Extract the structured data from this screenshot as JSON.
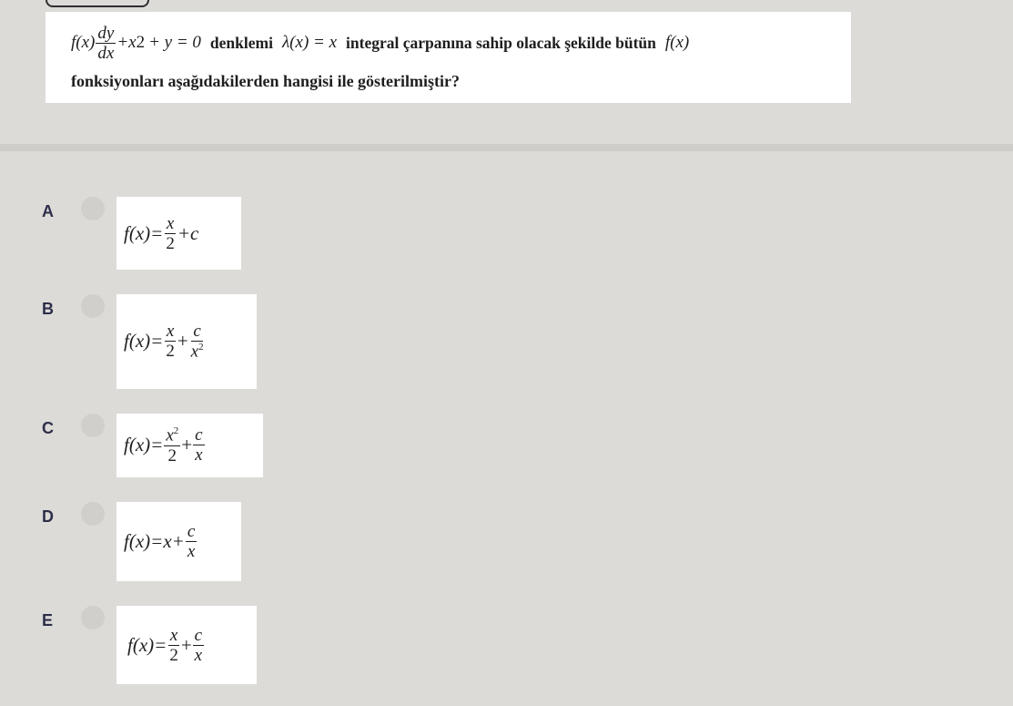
{
  "question": {
    "line1": {
      "f_of_x": "f(x)",
      "dy": "dy",
      "dx": "dx",
      "plus_x": "+x",
      "sq": "2",
      "plus_y_eq_0": "+ y = 0",
      "word_denklemi": "denklemi",
      "lambda": "λ(x) = x",
      "word_tail": "integral çarpanına sahip olacak şekilde bütün",
      "f_of_x_end": "f(x)"
    },
    "line2": "fonksiyonları aşağıdakilerden hangisi ile gösterilmiştir?"
  },
  "options": [
    {
      "letter": "A",
      "lhs": "f(x)=",
      "t1_num": "x",
      "t1_den": "2",
      "rest": "+c"
    },
    {
      "letter": "B",
      "lhs": "f(x)=",
      "t1_num": "x",
      "t1_den": "2",
      "plus": "+",
      "t2_num": "c",
      "t2_den": "x",
      "t2_den_sup": "2"
    },
    {
      "letter": "C",
      "lhs": "f(x)=",
      "t1_num": "x",
      "t1_num_sup": "2",
      "t1_den": "2",
      "plus": "+",
      "t2_num": "c",
      "t2_den": "x"
    },
    {
      "letter": "D",
      "lhs": "f(x)=x+",
      "t2_num": "c",
      "t2_den": "x"
    },
    {
      "letter": "E",
      "lhs": "f(x)=",
      "t1_num": "x",
      "t1_den": "2",
      "plus": "+",
      "t2_num": "c",
      "t2_den": "x"
    }
  ]
}
